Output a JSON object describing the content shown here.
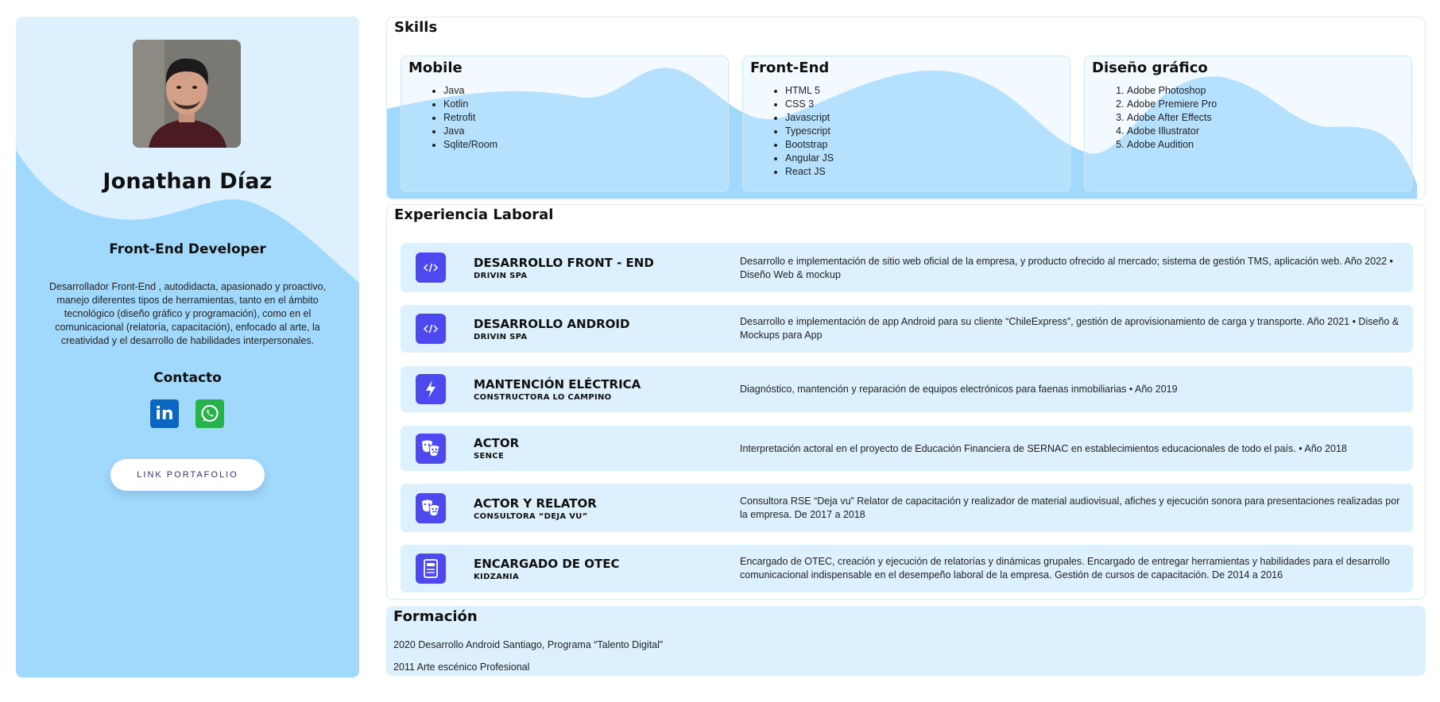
{
  "profile": {
    "name": "Jonathan Díaz",
    "role": "Front-End Developer",
    "bio": "Desarrollador Front-End , autodidacta, apasionado y proactivo, manejo diferentes tipos de herramientas, tanto en el ámbito tecnológico (diseño gráfico y programación), como en el comunicacional (relatoría, capacitación), enfocado al arte, la creatividad y el desarrollo de habilidades interpersonales.",
    "contact_title": "Contacto",
    "social": [
      {
        "icon": "linkedin-icon",
        "label": "in",
        "color": "#0a66c2"
      },
      {
        "icon": "whatsapp-icon",
        "color": "#25b34a"
      }
    ],
    "portfolio_button": "LINK PORTAFOLIO"
  },
  "skills": {
    "title": "Skills",
    "cards": [
      {
        "title": "Mobile",
        "list_type": "bullet",
        "items": [
          "Java",
          "Kotlin",
          "Retrofit",
          "Java",
          "Sqlite/Room"
        ]
      },
      {
        "title": "Front-End",
        "list_type": "bullet",
        "items": [
          "HTML 5",
          "CSS 3",
          "Javascript",
          "Typescript",
          "Bootstrap",
          "Angular JS",
          "React JS"
        ]
      },
      {
        "title": "Diseño gráfico",
        "list_type": "numbered",
        "items": [
          "Adobe Photoshop",
          "Adobe Premiere Pro",
          "Adobe After Effects",
          "Adobe Illustrator",
          "Adobe Audition"
        ]
      }
    ]
  },
  "experience": {
    "title": "Experiencia Laboral",
    "jobs": [
      {
        "icon": "code-icon",
        "title": "DESARROLLO FRONT - END",
        "company": "DRIVIN SPA",
        "description": "Desarrollo e implementación de sitio web oficial de la empresa, y producto ofrecido al mercado; sistema de gestión TMS, aplicación web. Año 2022 • Diseño Web & mockup"
      },
      {
        "icon": "code-icon",
        "title": "DESARROLLO ANDROID",
        "company": "DRIVIN SPA",
        "description": "Desarrollo e implementación de app Android para su cliente “ChileExpress”, gestión de aprovisionamiento de carga y transporte. Año 2021 • Diseño & Mockups para App"
      },
      {
        "icon": "lightning-icon",
        "title": "MANTENCIÓN ELÉCTRICA",
        "company": "CONSTRUCTORA LO CAMPINO",
        "description": "Diagnóstico, mantención y reparación de equipos electrónicos para faenas inmobiliarias • Año 2019"
      },
      {
        "icon": "theater-masks-icon",
        "title": "ACTOR",
        "company": "SENCE",
        "description": "Interpretación actoral en el proyecto de Educación Financiera de SERNAC en establecimientos educacionales de todo el país. • Año 2018"
      },
      {
        "icon": "theater-masks-icon",
        "title": "ACTOR Y RELATOR",
        "company": "CONSULTORA “DEJA VU”",
        "description": "Consultora RSE “Deja vu” Relator de capacitación y realizador de material audiovisual, afiches y ejecución sonora para presentaciones realizadas por la empresa. De 2017 a 2018"
      },
      {
        "icon": "document-icon",
        "title": "ENCARGADO DE OTEC",
        "company": "KIDZANIA",
        "description": "Encargado de OTEC, creación y ejecución de relatorías y dinámicas grupales. Encargado de entregar herramientas y habilidades para el desarrollo comunicacional indispensable en el desempeño laboral de la empresa. Gestión de cursos de capacitación. De 2014 a 2016"
      }
    ]
  },
  "formacion": {
    "title": "Formación",
    "items": [
      "2020 Desarrollo Android Santiago, Programa “Talento Digital”",
      "2011 Arte escénico Profesional"
    ]
  },
  "colors": {
    "card_bg": "#dcf0fe",
    "wave": "#a1d9fd",
    "icon_bg": "#4d49ef"
  }
}
